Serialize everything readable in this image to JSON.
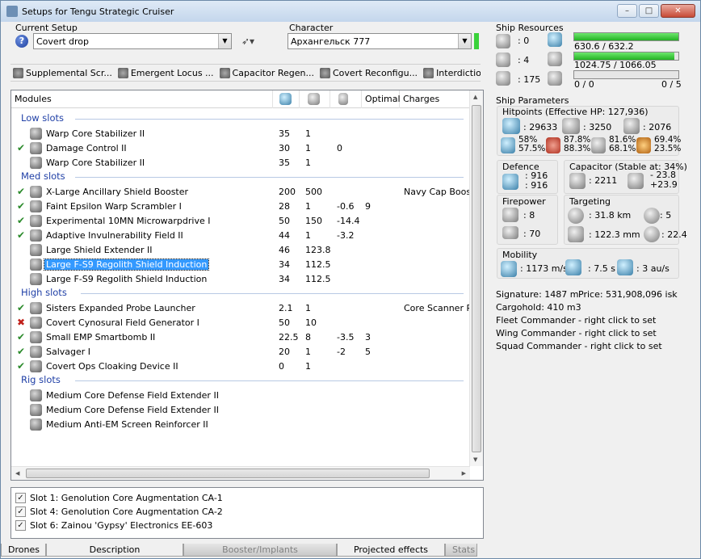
{
  "window": {
    "title": "Setups for Tengu Strategic Cruiser",
    "min": "–",
    "max": "□",
    "close": "✕"
  },
  "setup": {
    "label": "Current Setup",
    "value": "Covert drop"
  },
  "character": {
    "label": "Character",
    "value": "Архангельск 777"
  },
  "subsystems": [
    "Supplemental Scr...",
    "Emergent Locus ...",
    "Capacitor Regen...",
    "Covert Reconfigu...",
    "Interdiction Nullifier"
  ],
  "modules": {
    "headers": [
      "Modules",
      "",
      "",
      "",
      "Optimal",
      "Charges"
    ],
    "sections": [
      {
        "title": "Low slots",
        "rows": [
          {
            "status": "",
            "name": "Warp Core Stabilizer II",
            "c1": "35",
            "c2": "1",
            "c3": "",
            "c4": "",
            "c5": ""
          },
          {
            "status": "ok",
            "name": "Damage Control II",
            "c1": "30",
            "c2": "1",
            "c3": "0",
            "c4": "",
            "c5": ""
          },
          {
            "status": "",
            "name": "Warp Core Stabilizer II",
            "c1": "35",
            "c2": "1",
            "c3": "",
            "c4": "",
            "c5": ""
          }
        ]
      },
      {
        "title": "Med slots",
        "rows": [
          {
            "status": "ok",
            "name": "X-Large Ancillary Shield Booster",
            "c1": "200",
            "c2": "500",
            "c3": "",
            "c4": "",
            "c5": "Navy Cap Booster"
          },
          {
            "status": "ok",
            "name": "Faint Epsilon Warp Scrambler I",
            "c1": "28",
            "c2": "1",
            "c3": "-0.6",
            "c4": "9",
            "c5": ""
          },
          {
            "status": "ok",
            "name": "Experimental 10MN Microwarpdrive I",
            "c1": "50",
            "c2": "150",
            "c3": "-14.4",
            "c4": "",
            "c5": ""
          },
          {
            "status": "ok",
            "name": "Adaptive Invulnerability Field II",
            "c1": "44",
            "c2": "1",
            "c3": "-3.2",
            "c4": "",
            "c5": ""
          },
          {
            "status": "",
            "name": "Large Shield Extender II",
            "c1": "46",
            "c2": "123.8",
            "c3": "",
            "c4": "",
            "c5": ""
          },
          {
            "status": "",
            "name": "Large F-S9 Regolith Shield Induction",
            "c1": "34",
            "c2": "112.5",
            "c3": "",
            "c4": "",
            "c5": "",
            "selected": true
          },
          {
            "status": "",
            "name": "Large F-S9 Regolith Shield Induction",
            "c1": "34",
            "c2": "112.5",
            "c3": "",
            "c4": "",
            "c5": ""
          }
        ]
      },
      {
        "title": "High slots",
        "rows": [
          {
            "status": "ok",
            "name": "Sisters Expanded Probe Launcher",
            "c1": "2.1",
            "c2": "1",
            "c3": "",
            "c4": "",
            "c5": "Core Scanner Probe"
          },
          {
            "status": "bad",
            "name": "Covert Cynosural Field Generator I",
            "c1": "50",
            "c2": "10",
            "c3": "",
            "c4": "",
            "c5": ""
          },
          {
            "status": "ok",
            "name": "Small EMP Smartbomb II",
            "c1": "22.5",
            "c2": "8",
            "c3": "-3.5",
            "c4": "3",
            "c5": ""
          },
          {
            "status": "ok",
            "name": "Salvager I",
            "c1": "20",
            "c2": "1",
            "c3": "-2",
            "c4": "5",
            "c5": ""
          },
          {
            "status": "ok",
            "name": "Covert Ops Cloaking Device II",
            "c1": "0",
            "c2": "1",
            "c3": "",
            "c4": "",
            "c5": ""
          }
        ]
      },
      {
        "title": "Rig slots",
        "rows": [
          {
            "status": "",
            "name": "Medium Core Defense Field Extender II",
            "c1": "",
            "c2": "",
            "c3": "",
            "c4": "",
            "c5": ""
          },
          {
            "status": "",
            "name": "Medium Core Defense Field Extender II",
            "c1": "",
            "c2": "",
            "c3": "",
            "c4": "",
            "c5": ""
          },
          {
            "status": "",
            "name": "Medium Anti-EM Screen Reinforcer II",
            "c1": "",
            "c2": "",
            "c3": "",
            "c4": "",
            "c5": ""
          }
        ]
      }
    ]
  },
  "implants": [
    "Slot 1: Genolution Core Augmentation CA-1",
    "Slot 4: Genolution Core Augmentation CA-2",
    "Slot 6: Zainou 'Gypsy' Electronics EE-603"
  ],
  "tabs": [
    "Drones",
    "Description",
    "Booster/Implants",
    "Projected effects",
    "Stats"
  ],
  "resources": {
    "title": "Ship Resources",
    "counts": [
      ": 0",
      ": 4",
      ": 175"
    ],
    "cpu": {
      "text": "630.6 / 632.2",
      "fraction": 0.997
    },
    "power": {
      "text": "1024.75 / 1066.05",
      "fraction": 0.961
    },
    "drone": {
      "text": "0 / 0",
      "slots": "0 / 5",
      "fraction": 0
    }
  },
  "params": {
    "title": "Ship Parameters",
    "hp_title": "Hitpoints (Effective HP: 127,936)",
    "hp": [
      ": 29633",
      ": 3250",
      ": 2076"
    ],
    "resists": [
      [
        "58%",
        "57.5%"
      ],
      [
        "87.8%",
        "88.3%"
      ],
      [
        "81.6%",
        "68.1%"
      ],
      [
        "69.4%",
        "23.5%"
      ]
    ],
    "defence": {
      "title": "Defence",
      "v1": ": 916",
      "v2": ": 916"
    },
    "capacitor": {
      "title": "Capacitor (Stable at: 34%)",
      "amount": ": 2211",
      "d1": "- 23.8",
      "d2": "+23.9"
    },
    "firepower": {
      "title": "Firepower",
      "v1": ": 8",
      "v2": ": 70"
    },
    "targeting": {
      "title": "Targeting",
      "range": ": 31.8 km",
      "targets": ": 5",
      "res": ": 122.3 mm",
      "scan": ": 22.4"
    },
    "mobility": {
      "title": "Mobility",
      "speed": ": 1173 m/s",
      "align": ": 7.5 s",
      "warp": ": 3 au/s"
    }
  },
  "info": {
    "signature": "Signature: 1487 m",
    "price": "Price: 531,908,096 isk",
    "cargo": "Cargohold: 410 m3",
    "fleet": "Fleet Commander - right click to set",
    "wing": "Wing Commander - right click to set",
    "squad": "Squad Commander - right click to set"
  }
}
